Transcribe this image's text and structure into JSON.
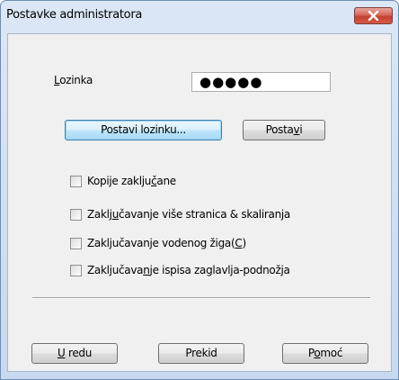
{
  "window": {
    "title": "Postavke administratora",
    "close_icon": "close-icon"
  },
  "password": {
    "label_underlined": "L",
    "label_rest": "ozinka",
    "value": "●●●●●"
  },
  "buttons": {
    "set_password": "Postavi lozinku...",
    "set_pre": "Posta",
    "set_underlined": "v",
    "set_post": "i",
    "ok_underlined": "U",
    "ok_rest": " redu",
    "cancel": "Prekid",
    "help_pre": "P",
    "help_underlined": "o",
    "help_post": "moć"
  },
  "options": [
    {
      "pre": "Kopije zaklju",
      "underlined": "č",
      "post": "ane",
      "checked": false
    },
    {
      "pre": "Zaklj",
      "underlined": "u",
      "post": "čavanje više stranica & skaliranja",
      "checked": false
    },
    {
      "pre": "Zaključavanje vodenog žiga(",
      "underlined": "C",
      "post": ")",
      "checked": false
    },
    {
      "pre": "Zaključava",
      "underlined": "n",
      "post": "je ispisa zaglavlja-podnožja",
      "checked": false
    }
  ]
}
